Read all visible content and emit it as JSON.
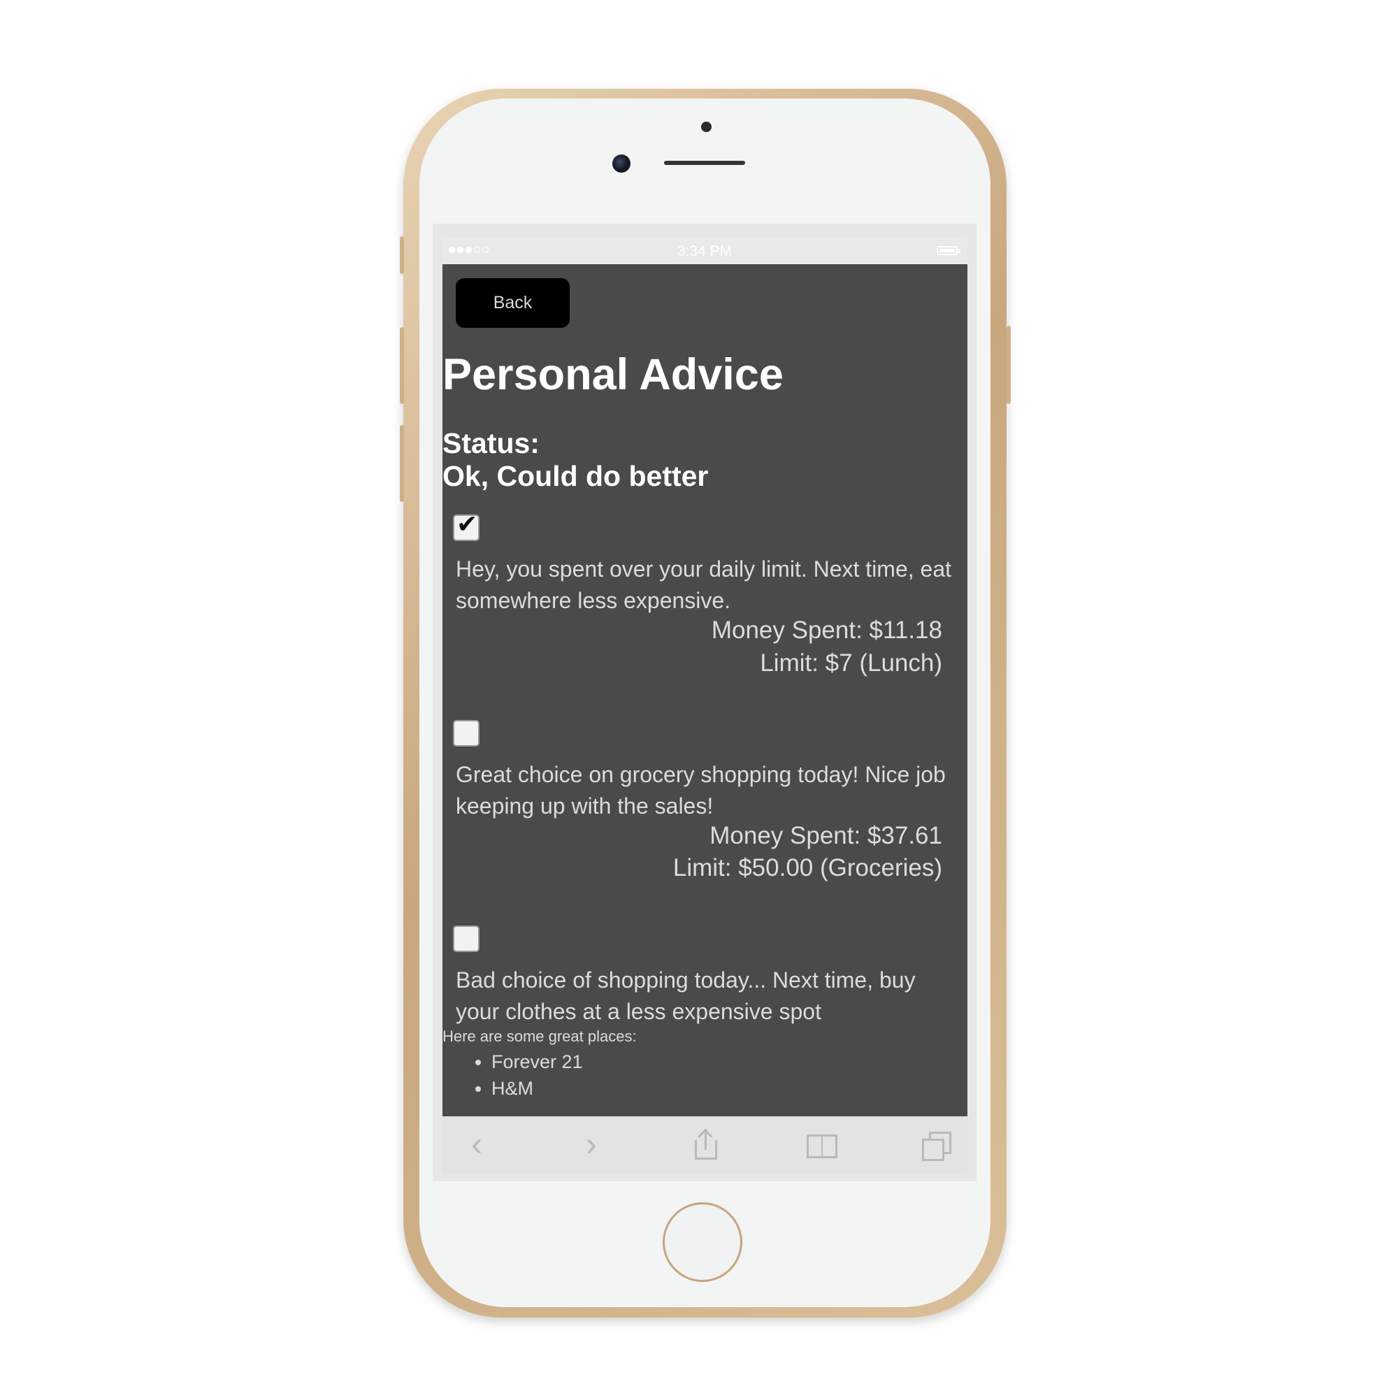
{
  "statusbar": {
    "time": "3:34 PM"
  },
  "header": {
    "back_label": "Back",
    "title": "Personal Advice"
  },
  "status": {
    "label": "Status:",
    "value": "Ok, Could do better"
  },
  "advice": [
    {
      "checked": true,
      "text": "Hey, you spent over your daily limit. Next time, eat somewhere less expensive.",
      "spent": "Money Spent: $11.18",
      "limit": "Limit: $7 (Lunch)"
    },
    {
      "checked": false,
      "text": "Great choice on grocery shopping today! Nice job keeping up with the sales!",
      "spent": "Money Spent: $37.61",
      "limit": "Limit: $50.00 (Groceries)"
    },
    {
      "checked": false,
      "text": "Bad choice of shopping today... Next time, buy your clothes at a less expensive spot"
    }
  ],
  "places": {
    "intro": "Here are some great places:",
    "items": [
      "Forever 21",
      "H&M"
    ]
  },
  "toolbar": {
    "icons": [
      "back-arrow-icon",
      "forward-arrow-icon",
      "share-icon",
      "bookmarks-icon",
      "tabs-icon"
    ]
  },
  "colors": {
    "content_background": "#4a4a4a",
    "button_background": "#000000",
    "phone_frame": "#d4b896"
  }
}
